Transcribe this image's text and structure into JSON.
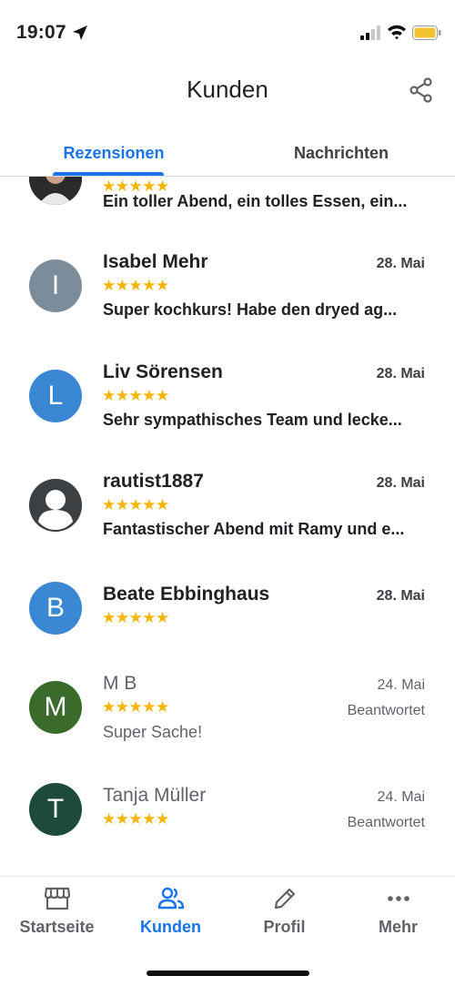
{
  "status_bar": {
    "time": "19:07"
  },
  "header": {
    "title": "Kunden",
    "share_icon": "share-icon"
  },
  "tabs": [
    {
      "label": "Rezensionen",
      "active": true
    },
    {
      "label": "Nachrichten",
      "active": false
    }
  ],
  "reviews": [
    {
      "name": "",
      "avatar_letter": "",
      "avatar_color": "#3a3a3a",
      "rating": 5,
      "date": "",
      "text": "Ein toller Abend, ein tolles Essen, ein...",
      "replied": ""
    },
    {
      "name": "Isabel Mehr",
      "avatar_letter": "I",
      "avatar_color": "#7b8d9b",
      "rating": 5,
      "date": "28. Mai",
      "text": "Super kochkurs! Habe den dryed ag...",
      "replied": ""
    },
    {
      "name": "Liv Sörensen",
      "avatar_letter": "L",
      "avatar_color": "#3a87d4",
      "rating": 5,
      "date": "28. Mai",
      "text": "Sehr sympathisches Team und lecke...",
      "replied": ""
    },
    {
      "name": "rautist1887",
      "avatar_letter": "",
      "avatar_color": "#3c4043",
      "rating": 5,
      "date": "28. Mai",
      "text": "Fantastischer Abend mit Ramy und e...",
      "replied": ""
    },
    {
      "name": "Beate Ebbinghaus",
      "avatar_letter": "B",
      "avatar_color": "#3a87d4",
      "rating": 5,
      "date": "28. Mai",
      "text": "",
      "replied": ""
    },
    {
      "name": "M B",
      "avatar_letter": "M",
      "avatar_color": "#3b6b2a",
      "rating": 5,
      "date": "24. Mai",
      "text": "Super Sache!",
      "replied": "Beantwortet"
    },
    {
      "name": "Tanja Müller",
      "avatar_letter": "T",
      "avatar_color": "#1d4a3d",
      "rating": 5,
      "date": "24. Mai",
      "text": "",
      "replied": "Beantwortet"
    }
  ],
  "stars_text": "★★★★★",
  "bottom_nav": [
    {
      "label": "Startseite",
      "icon": "storefront-icon",
      "active": false
    },
    {
      "label": "Kunden",
      "icon": "people-icon",
      "active": true
    },
    {
      "label": "Profil",
      "icon": "pencil-icon",
      "active": false
    },
    {
      "label": "Mehr",
      "icon": "more-dots-icon",
      "active": false
    }
  ],
  "colors": {
    "accent": "#1a73e8",
    "star": "#f4b400"
  }
}
